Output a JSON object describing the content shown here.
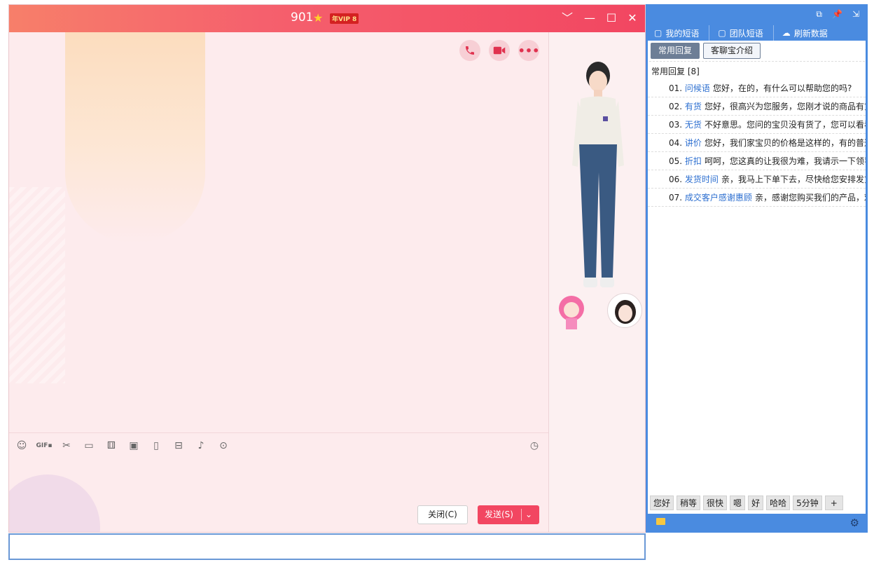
{
  "chat": {
    "title": "901",
    "vip_badge": "年VIP 8",
    "buttons": {
      "close": "关闭(C)",
      "send": "发送(S)"
    },
    "toolbar_icons": [
      "smile-icon",
      "gif-icon",
      "scissors-icon",
      "folder-icon",
      "shake-icon",
      "image-icon",
      "vibrate-icon",
      "red-packet-icon",
      "music-icon",
      "more-icon"
    ]
  },
  "quick_reply": {
    "tabs": [
      {
        "label": "我的短语",
        "icon": "chat-bubble-icon"
      },
      {
        "label": "团队短语",
        "icon": "team-chat-icon"
      },
      {
        "label": "刷新数据",
        "icon": "cloud-icon"
      }
    ],
    "sub_buttons": [
      {
        "label": "常用回复",
        "active": true
      },
      {
        "label": "客聊宝介绍",
        "active": false
      }
    ],
    "category": "常用回复 [8]",
    "items": [
      {
        "num": "01.",
        "tag": "问候语",
        "text": "您好，在的，有什么可以帮助您的吗?"
      },
      {
        "num": "02.",
        "tag": "有货",
        "text": "您好，很高兴为您服务，您刚才说的商品有货"
      },
      {
        "num": "03.",
        "tag": "无货",
        "text": "不好意思。您问的宝贝没有货了，您可以看看"
      },
      {
        "num": "04.",
        "tag": "讲价",
        "text": "您好，我们家宝贝的价格是这样的，有的普通"
      },
      {
        "num": "05.",
        "tag": "折扣",
        "text": "呵呵，您这真的让我很为难，我请示一下领导"
      },
      {
        "num": "06.",
        "tag": "发货时间",
        "text": "亲，我马上下单下去，尽快给您安排发货"
      },
      {
        "num": "07.",
        "tag": "成交客户感谢惠顾",
        "text": "亲，感谢您购买我们的产品，欢迎"
      }
    ],
    "chips": [
      "您好",
      "稍等",
      "很快",
      "嗯",
      "好",
      "哈哈",
      "5分钟",
      "+"
    ]
  }
}
